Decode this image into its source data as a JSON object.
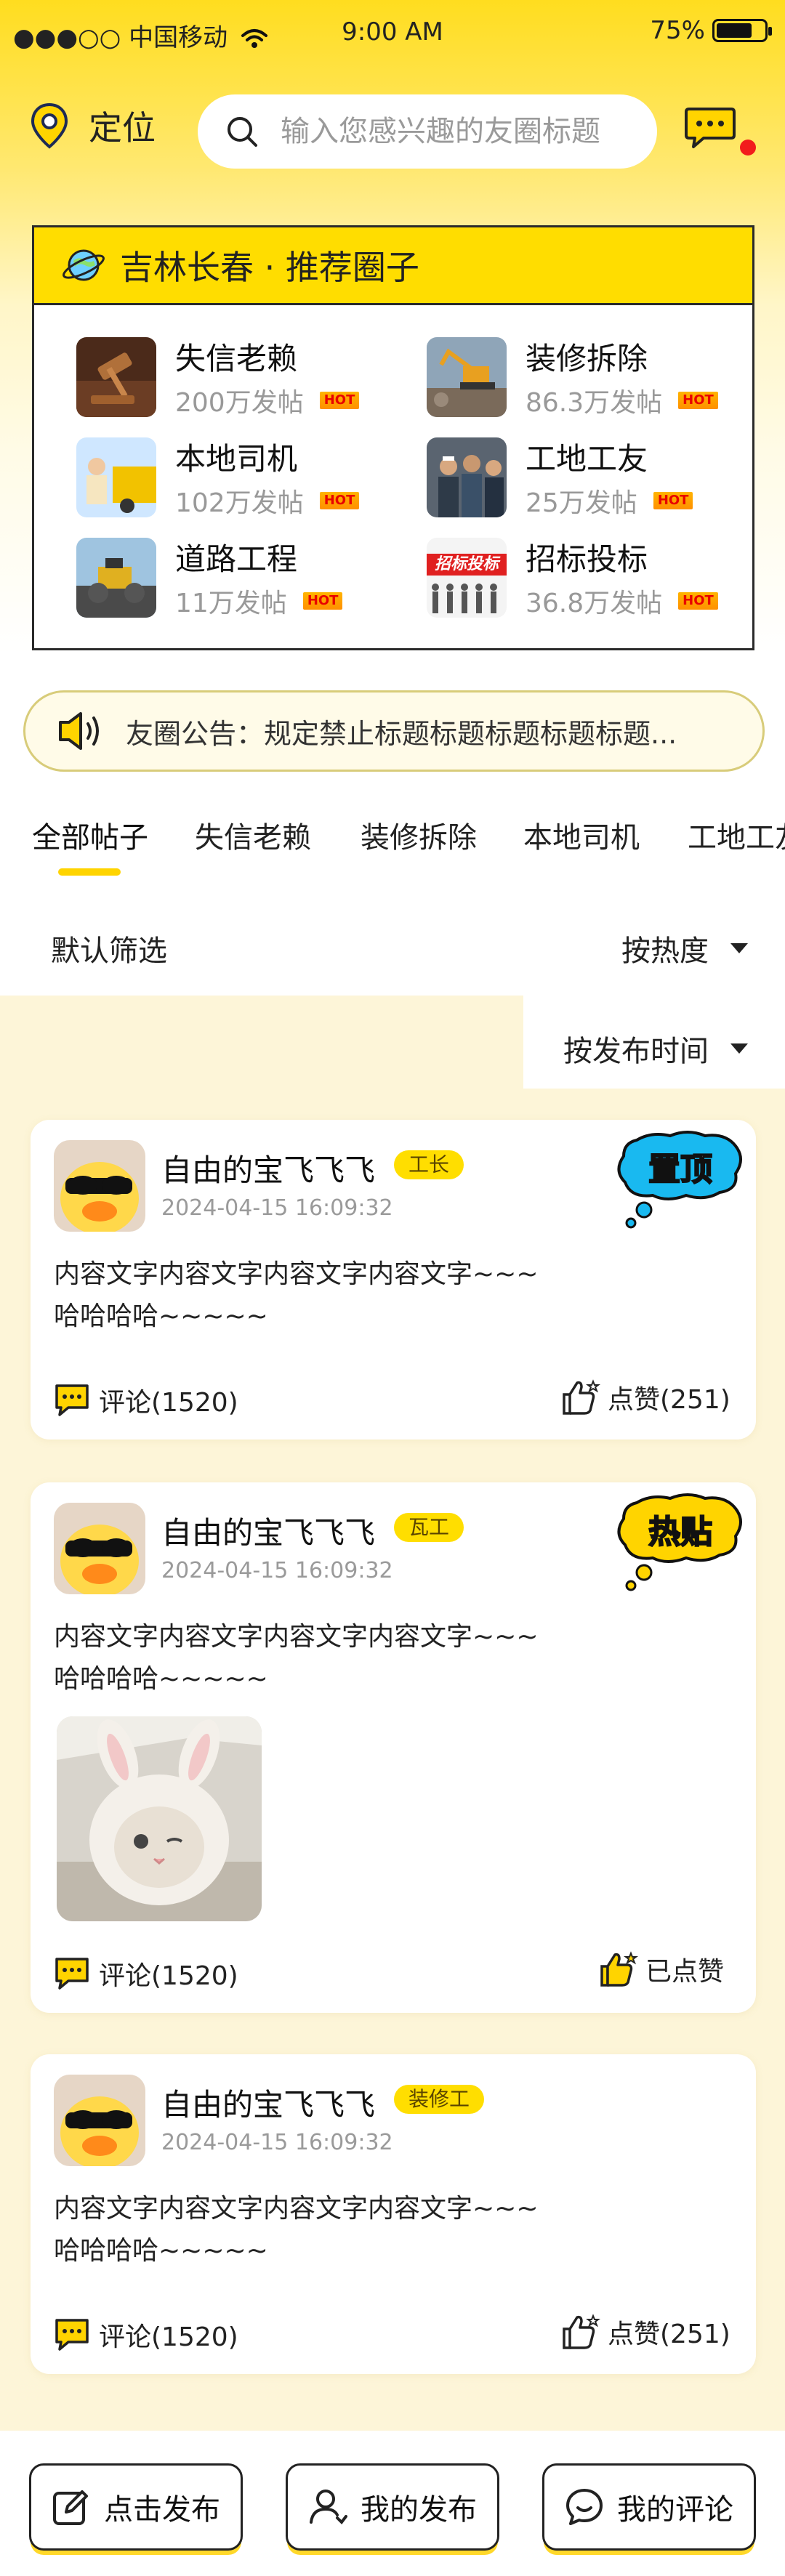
{
  "status_bar": {
    "carrier": "●●●○○ 中国移动",
    "time": "9:00 AM",
    "battery": "75%",
    "battery_level": 0.75
  },
  "header": {
    "location_label": "定位",
    "search_placeholder": "输入您感兴趣的友圈标题"
  },
  "recommend": {
    "title": "吉林长春 · 推荐圈子",
    "items": [
      {
        "name": "失信老赖",
        "posts": "200万发帖",
        "badge": "HOT",
        "thumb_icon": "gavel-thumbnail"
      },
      {
        "name": "装修拆除",
        "posts": "86.3万发帖",
        "badge": "HOT",
        "thumb_icon": "excavator-thumbnail"
      },
      {
        "name": "本地司机",
        "posts": "102万发帖",
        "badge": "HOT",
        "thumb_icon": "driver-thumbnail"
      },
      {
        "name": "工地工友",
        "posts": "25万发帖",
        "badge": "HOT",
        "thumb_icon": "workers-thumbnail"
      },
      {
        "name": "道路工程",
        "posts": "11万发帖",
        "badge": "HOT",
        "thumb_icon": "roadroller-thumbnail"
      },
      {
        "name": "招标投标",
        "posts": "36.8万发帖",
        "badge": "HOT",
        "thumb_icon": "bidding-thumbnail",
        "thumb_text": "招标投标"
      }
    ]
  },
  "notice": {
    "text": "友圈公告：规定禁止标题标题标题标题标题..."
  },
  "tabs": [
    "全部帖子",
    "失信老赖",
    "装修拆除",
    "本地司机",
    "工地工友"
  ],
  "filters": {
    "default": "默认筛选",
    "hot": "按热度",
    "time": "按发布时间"
  },
  "posts": [
    {
      "user": "自由的宝飞飞飞",
      "role": "工长",
      "time": "2024-04-15  16:09:32",
      "line1": "内容文字内容文字内容文字内容文字~~~",
      "line2": "哈哈哈哈~~~~~",
      "comment": "评论(1520)",
      "like": "点赞(251)",
      "sticker": "置顶",
      "liked": false
    },
    {
      "user": "自由的宝飞飞飞",
      "role": "瓦工",
      "time": "2024-04-15  16:09:32",
      "line1": "内容文字内容文字内容文字内容文字~~~",
      "line2": "哈哈哈哈~~~~~",
      "comment": "评论(1520)",
      "like": "已点赞",
      "sticker": "热贴",
      "liked": true
    },
    {
      "user": "自由的宝飞飞飞",
      "role": "装修工",
      "time": "2024-04-15  16:09:32",
      "line1": "内容文字内容文字内容文字内容文字~~~",
      "line2": "哈哈哈哈~~~~~",
      "comment": "评论(1520)",
      "like": "点赞(251)",
      "liked": false
    }
  ],
  "bottom_bar": {
    "publish": "点击发布",
    "my_posts": "我的发布",
    "my_comments": "我的评论"
  },
  "colors": {
    "accent": "#ffdd00",
    "sticker_blue": "#19b9f0",
    "dot_red": "#f21c1c",
    "hot_orange": "#ffa200"
  }
}
